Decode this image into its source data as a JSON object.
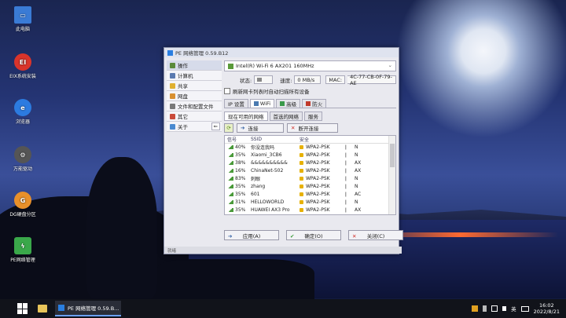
{
  "desktop": {
    "icons": [
      {
        "label": "此电脑",
        "icon": "computer-icon",
        "color": "#3a7bd5"
      },
      {
        "label": "EIX系统安装",
        "icon": "eix-icon",
        "color": "#d9342b"
      },
      {
        "label": "浏览器",
        "icon": "browser-icon",
        "color": "#2c7be0"
      },
      {
        "label": "万能驱动",
        "icon": "gear-icon",
        "color": "#555555"
      },
      {
        "label": "DG硬盘分区",
        "icon": "dg-icon",
        "color": "#e8902a"
      },
      {
        "label": "PE网络管理",
        "icon": "network-icon",
        "color": "#3aa84a"
      }
    ]
  },
  "window": {
    "title": "PE 网络管理 0.59.B12",
    "sidebar": [
      {
        "label": "操作",
        "icon": "operate-icon"
      },
      {
        "label": "计算机",
        "icon": "computer-icon"
      },
      {
        "label": "共享",
        "icon": "share-icon"
      },
      {
        "label": "网盘",
        "icon": "netdisk-icon"
      },
      {
        "label": "文件和配置文件",
        "icon": "file-config-icon"
      },
      {
        "label": "其它",
        "icon": "other-icon"
      },
      {
        "label": "关于",
        "icon": "about-icon"
      }
    ],
    "adapter": "Intel(R) Wi-Fi 6 AX201 160MHz",
    "status_label": "状态:",
    "speed_label": "速度:",
    "speed_value": "0 MB/s",
    "mac_label": "MAC:",
    "mac_value": "4C-77-CB-0F-79-AE",
    "refresh_check_label": "刷新网卡列表时自动扫描所有设备",
    "tabs": [
      {
        "label": "IP 设置"
      },
      {
        "label": "WiFi"
      },
      {
        "label": "高级"
      },
      {
        "label": "防火"
      }
    ],
    "subtabs": [
      "现在可用的网络",
      "首选的网络",
      "服务"
    ],
    "toolbar": {
      "connect": "连接",
      "disconnect": "断开连接"
    },
    "table": {
      "headers": [
        "信号",
        "SSID",
        "安全",
        "",
        ""
      ],
      "rows": [
        {
          "signal": "40%",
          "ssid": "你没连我吗",
          "security": "WPA2-PSK",
          "ch": "N"
        },
        {
          "signal": "35%",
          "ssid": "Xiaomi_3CB6",
          "security": "WPA2-PSK",
          "ch": "N"
        },
        {
          "signal": "38%",
          "ssid": "&&&&&&&&&&",
          "security": "WPA2-PSK",
          "ch": "AX"
        },
        {
          "signal": "16%",
          "ssid": "ChinaNet-502",
          "security": "WPA2-PSK",
          "ch": "AX"
        },
        {
          "signal": "83%",
          "ssid": "刺眼",
          "security": "WPA2-PSK",
          "ch": "N"
        },
        {
          "signal": "35%",
          "ssid": "zhang",
          "security": "WPA2-PSK",
          "ch": "N"
        },
        {
          "signal": "35%",
          "ssid": "601",
          "security": "WPA2-PSK",
          "ch": "AC"
        },
        {
          "signal": "31%",
          "ssid": "HELLOWORLD",
          "security": "WPA2-PSK",
          "ch": "N"
        },
        {
          "signal": "35%",
          "ssid": "HUAWEI AX3 Pro",
          "security": "WPA2-PSK",
          "ch": "AX"
        }
      ]
    },
    "footer": {
      "apply": "应用(A)",
      "ok": "确定(O)",
      "close": "关闭(C)"
    },
    "status_bar": "就绪"
  },
  "taskbar": {
    "app_label": "PE 网络管理 0.59.B...",
    "ime": "英",
    "time": "16:02",
    "date": "2022/8/21"
  }
}
